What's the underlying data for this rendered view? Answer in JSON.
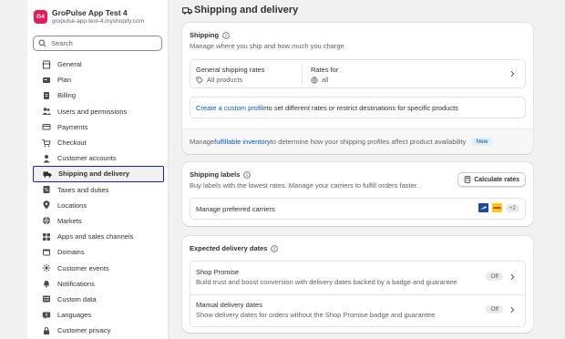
{
  "store": {
    "initials": "G4",
    "name": "GroPulse App Test 4",
    "domain": "gropulse-app-test-4.myshopify.com"
  },
  "search": {
    "placeholder": "Search"
  },
  "nav": [
    {
      "label": "General",
      "icon": "store-icon"
    },
    {
      "label": "Plan",
      "icon": "plan-icon"
    },
    {
      "label": "Billing",
      "icon": "billing-icon"
    },
    {
      "label": "Users and permissions",
      "icon": "users-icon"
    },
    {
      "label": "Payments",
      "icon": "payments-icon"
    },
    {
      "label": "Checkout",
      "icon": "cart-icon"
    },
    {
      "label": "Customer accounts",
      "icon": "person-icon"
    },
    {
      "label": "Shipping and delivery",
      "icon": "truck-icon",
      "active": true
    },
    {
      "label": "Taxes and duties",
      "icon": "tax-icon"
    },
    {
      "label": "Locations",
      "icon": "location-icon"
    },
    {
      "label": "Markets",
      "icon": "globe-icon"
    },
    {
      "label": "Apps and sales channels",
      "icon": "apps-icon"
    },
    {
      "label": "Domains",
      "icon": "domains-icon"
    },
    {
      "label": "Customer events",
      "icon": "events-icon"
    },
    {
      "label": "Notifications",
      "icon": "bell-icon"
    },
    {
      "label": "Custom data",
      "icon": "data-icon"
    },
    {
      "label": "Languages",
      "icon": "language-icon"
    },
    {
      "label": "Customer privacy",
      "icon": "lock-icon"
    }
  ],
  "page": {
    "title": "Shipping and delivery"
  },
  "shipping": {
    "title": "Shipping",
    "subtitle": "Manage where you ship and how much you charge",
    "general_rates_label": "General shipping rates",
    "all_products": "All products",
    "rates_for_label": "Rates for",
    "rates_for_value": "all",
    "custom_profile_link": "Create a custom profile",
    "custom_profile_text": " to set different rates or restrict destinations for specific products",
    "manage_prefix": "Manage ",
    "manage_link": "fulfillable inventory",
    "manage_suffix": " to determine how your shipping profiles affect product availability",
    "new_badge": "New"
  },
  "labels": {
    "title": "Shipping labels",
    "subtitle": "Buy labels with the lowest rates. Manage your carriers to fulfill orders faster.",
    "calculate_button": "Calculate rates",
    "carriers_label": "Manage preferred carriers",
    "carriers_more": "+2"
  },
  "delivery": {
    "title": "Expected delivery dates",
    "items": [
      {
        "title": "Shop Promise",
        "desc": "Build trust and boost conversion with delivery dates backed by a badge and guarantee",
        "status": "Off"
      },
      {
        "title": "Manual delivery dates",
        "desc": "Show delivery dates for orders without the Shop Promise badge and guarantee",
        "status": "Off"
      }
    ]
  },
  "colors": {
    "brand": "#e51c5a",
    "link": "#005bd3",
    "active_outline": "#1a1ae6",
    "usps": "#1b4a9c",
    "dhl": "#ffcc00"
  }
}
